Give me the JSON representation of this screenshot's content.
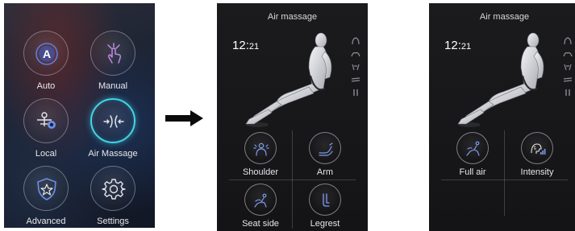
{
  "menu": {
    "items": [
      {
        "label": "Auto",
        "icon": "auto-a-icon"
      },
      {
        "label": "Manual",
        "icon": "hand-touch-icon"
      },
      {
        "label": "Local",
        "icon": "local-massage-icon"
      },
      {
        "label": "Air Massage",
        "icon": "air-massage-icon",
        "active": true
      },
      {
        "label": "Advanced",
        "icon": "shield-star-icon"
      },
      {
        "label": "Settings",
        "icon": "gear-icon"
      }
    ],
    "active_color": "#41d6e6"
  },
  "screen_air_parts": {
    "title": "Air massage",
    "clock": {
      "hours": "12",
      "minutes": "21"
    },
    "buttons": [
      {
        "label": "Shoulder",
        "icon": "shoulder-icon"
      },
      {
        "label": "Arm",
        "icon": "arm-icon"
      },
      {
        "label": "Seat side",
        "icon": "seat-side-icon"
      },
      {
        "label": "Legrest",
        "icon": "legrest-icon"
      }
    ]
  },
  "screen_air_modes": {
    "title": "Air massage",
    "clock": {
      "hours": "12",
      "minutes": "21"
    },
    "buttons": [
      {
        "label": "Full air",
        "icon": "full-air-icon"
      },
      {
        "label": "Intensity",
        "icon": "intensity-icon"
      }
    ]
  }
}
